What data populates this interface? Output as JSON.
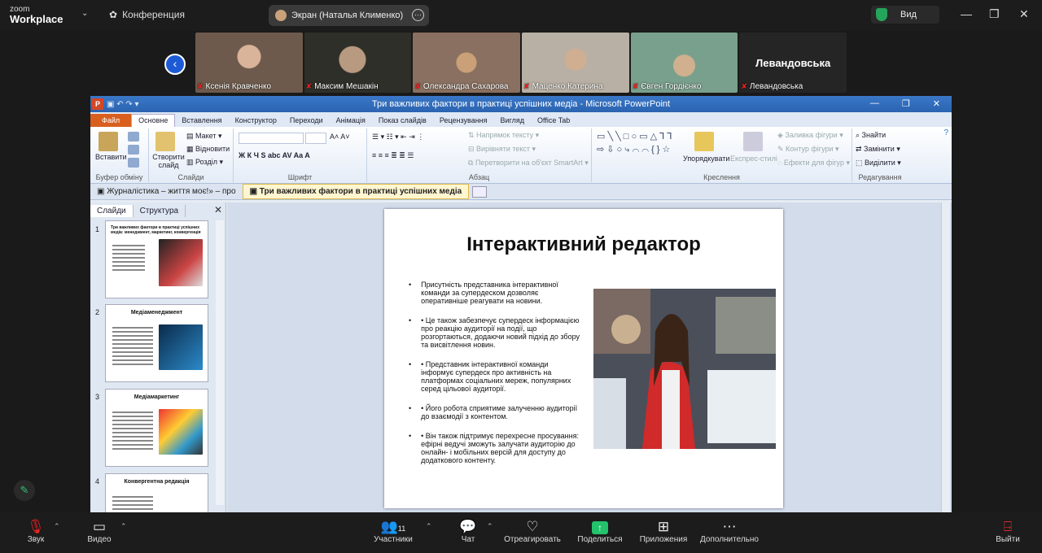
{
  "zoom": {
    "brand_top": "zoom",
    "brand_name": "Workplace",
    "meeting": "Конференция",
    "share_label": "Экран (Наталья Клименко)",
    "view_label": "Вид"
  },
  "participants": [
    {
      "name": "Ксенія Кравченко",
      "color": "#6d5a4c"
    },
    {
      "name": "Максим Мешакін",
      "color": "#3a3a32"
    },
    {
      "name": "Олександра Сахарова",
      "color": "#8a7060"
    },
    {
      "name": "Маценко Катерина",
      "color": "#b8b0a4"
    },
    {
      "name": "Євген Гордієнко",
      "color": "#79a08c"
    },
    {
      "name": "Левандовська",
      "color": "#252525",
      "title": "Левандовська"
    }
  ],
  "ppt": {
    "window_title": "Три важливих фактори в практиці успішних медіа  -  Microsoft PowerPoint",
    "tabs": [
      "Файл",
      "Основне",
      "Вставлення",
      "Конструктор",
      "Переходи",
      "Анімація",
      "Показ слайдів",
      "Рецензування",
      "Вигляд",
      "Office Tab"
    ],
    "ribbon": {
      "paste": "Вставити",
      "clipboard": "Буфер обміну",
      "create_slide": "Створити слайд",
      "layout": "Макет",
      "restore": "Відновити",
      "sections": "Розділ",
      "slides": "Слайди",
      "font": "Шрифт",
      "text_dir": "Напрямок тексту",
      "align_text": "Вирівняти текст",
      "smartart": "Перетворити на об'єкт SmartArt",
      "paragraph": "Абзац",
      "arrange": "Упорядкувати",
      "quick_styles": "Експрес-стилі",
      "shape_fill": "Заливка фігури",
      "shape_outline": "Контур фігури",
      "shape_effects": "Ефекти для фігур",
      "drawing": "Креслення",
      "find": "Знайти",
      "replace": "Замінити",
      "select": "Виділити",
      "editing": "Редагування"
    },
    "doc_tabs": [
      "Журналістика – життя моє!» – про",
      "Три важливих фактори в практиці успішних медіа"
    ],
    "pane_tabs": [
      "Слайди",
      "Структура"
    ],
    "thumbs": [
      {
        "num": "1",
        "title": "Три важливих фактори в практиці успішних медіа: менеджмент, маркетинг, конвергенція"
      },
      {
        "num": "2",
        "title": "Медіаменеджмент"
      },
      {
        "num": "3",
        "title": "Медіамаркетинг"
      },
      {
        "num": "4",
        "title": "Конвергентна редакція"
      }
    ],
    "slide": {
      "title": "Інтерактивний редактор",
      "bullets": [
        "Присутність представника інтерактивної команди за супердеском дозволяє оперативніше реагувати на новини.",
        "• Це також забезпечує супердеск інформацією про реакцію аудиторії на події, що розгортаються, додаючи новий підхід до збору та висвітлення новин.",
        "• Представник інтерактивної команди інформує супердеск про активність на платформах соціальних мереж, популярних серед цільової аудиторії.",
        "• Його робота сприятиме залученню аудиторії до взаємодії з контентом.",
        "• Він також підтримує перехресне просування: ефірні ведучі зможуть залучати аудиторію до онлайн- і мобільних версій для доступу до додаткового контенту."
      ]
    }
  },
  "toolbar": {
    "audio": "Звук",
    "video": "Видео",
    "participants": "Участники",
    "participants_count": "11",
    "chat": "Чат",
    "react": "Отреагировать",
    "share": "Поделиться",
    "apps": "Приложения",
    "more": "Дополнительно",
    "leave": "Выйти"
  },
  "colors": {
    "share_green": "#23c36b",
    "ppt_accent": "#d95f1e",
    "leave_red": "#e02828"
  }
}
